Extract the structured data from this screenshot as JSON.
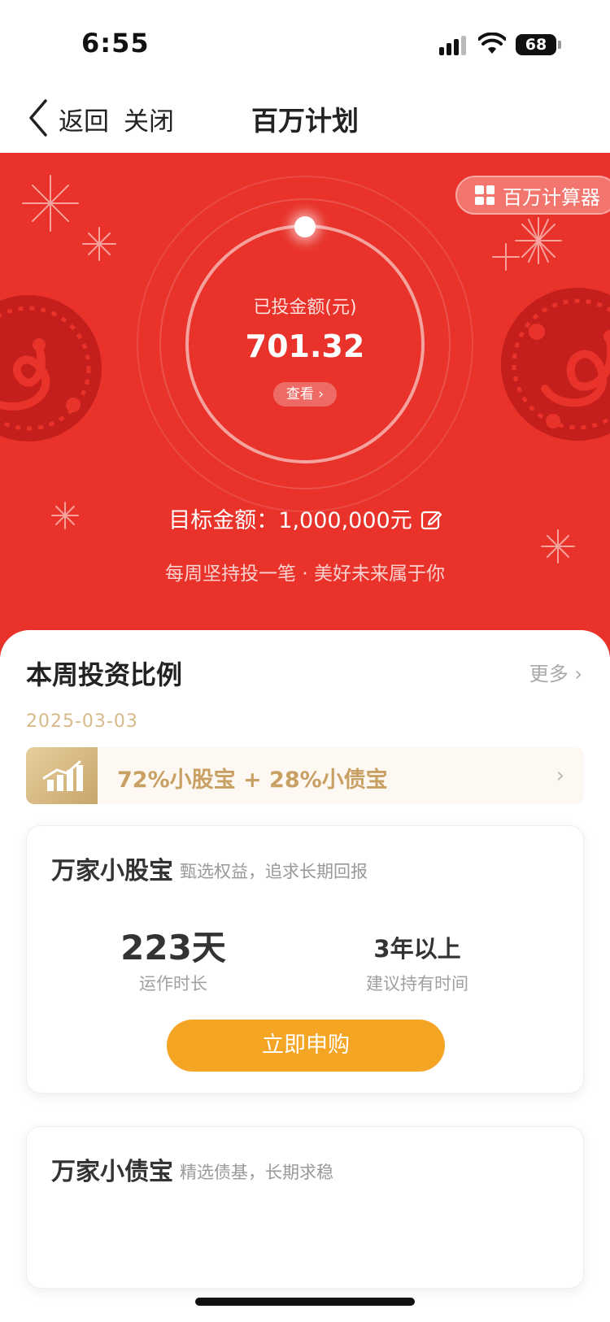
{
  "status_bar": {
    "time": "6:55",
    "battery": "68"
  },
  "nav": {
    "back_label": "返回",
    "close_label": "关闭",
    "title": "百万计划"
  },
  "hero": {
    "calculator_label": "百万计算器",
    "invested_label": "已投金额(元)",
    "invested_value": "701.32",
    "view_label": "查看 ›",
    "target_label": "目标金额：",
    "target_value": "1,000,000元",
    "slogan": "每周坚持投一笔 · 美好未来属于你"
  },
  "weekly": {
    "title": "本周投资比例",
    "more_label": "更多 ›",
    "date": "2025-03-03",
    "ratio_text": "72%小股宝 + 28%小债宝"
  },
  "funds": [
    {
      "name": "万家小股宝",
      "desc": "甄选权益，追求长期回报",
      "stat1_value": "223天",
      "stat1_label": "运作时长",
      "stat2_value": "3年以上",
      "stat2_label": "建议持有时间",
      "button_label": "立即申购"
    },
    {
      "name": "万家小债宝",
      "desc": "精选债基，长期求稳"
    }
  ],
  "colors": {
    "hero_red": "#e8322a",
    "gold": "#c9a063",
    "button_orange": "#f5a524"
  }
}
